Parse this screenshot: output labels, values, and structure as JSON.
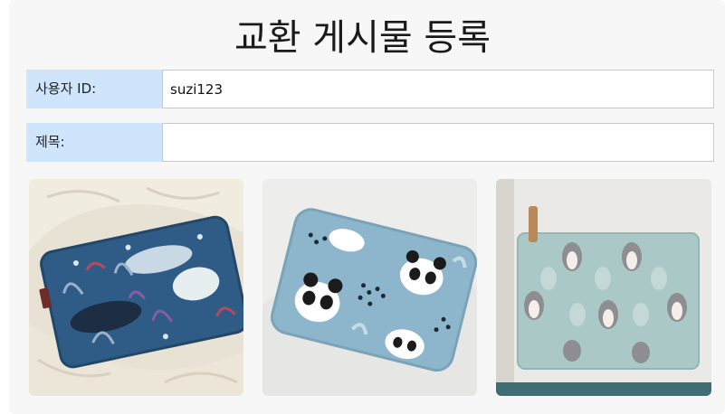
{
  "page": {
    "title": "교환 게시물 등록"
  },
  "form": {
    "user_id_label": "사용자 ID:",
    "user_id_value": "suzi123",
    "title_label": "제목:",
    "title_value": "",
    "title_placeholder": ""
  },
  "photos": [
    {
      "subject": "whale-pattern-pouch-photo"
    },
    {
      "subject": "panda-pattern-pouch-photo"
    },
    {
      "subject": "penguin-pattern-pouch-photo"
    }
  ],
  "colors": {
    "panel_bg": "#f7f7f7",
    "label_bg": "#cfe5fc",
    "input_border": "#c8c8c8"
  }
}
